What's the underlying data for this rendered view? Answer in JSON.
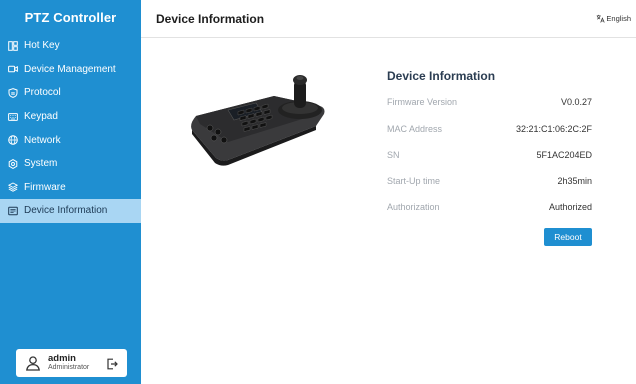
{
  "sidebar": {
    "brand": "PTZ Controller",
    "items": [
      {
        "label": "Hot Key",
        "icon": "hotkey-icon"
      },
      {
        "label": "Device Management",
        "icon": "camera-icon"
      },
      {
        "label": "Protocol",
        "icon": "shield-icon"
      },
      {
        "label": "Keypad",
        "icon": "keyboard-icon"
      },
      {
        "label": "Network",
        "icon": "globe-icon"
      },
      {
        "label": "System",
        "icon": "gear-icon"
      },
      {
        "label": "Firmware",
        "icon": "layers-icon"
      },
      {
        "label": "Device Information",
        "icon": "id-card-icon",
        "active": true
      }
    ],
    "user": {
      "name": "admin",
      "role": "Administrator"
    }
  },
  "header": {
    "title": "Device Information",
    "language": "English"
  },
  "info": {
    "title": "Device Information",
    "rows": [
      {
        "label": "Firmware Version",
        "value": "V0.0.27"
      },
      {
        "label": "MAC Address",
        "value": "32:21:C1:06:2C:2F"
      },
      {
        "label": "SN",
        "value": "5F1AC204ED"
      },
      {
        "label": "Start-Up time",
        "value": "2h35min"
      },
      {
        "label": "Authorization",
        "value": "Authorized"
      }
    ],
    "reboot_label": "Reboot"
  },
  "colors": {
    "sidebar": "#1f8fd1",
    "sidebar_active": "#a9d6f3",
    "button": "#1f8fd1"
  }
}
